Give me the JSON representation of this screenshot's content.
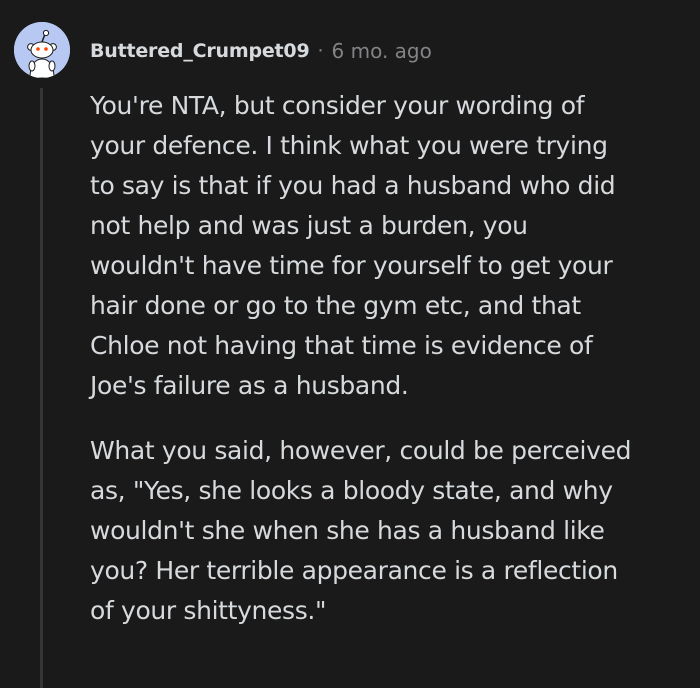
{
  "comment": {
    "avatar_icon": "snoo-avatar-icon",
    "avatar_color": "#b7c9f2",
    "username": "Buttered_Crumpet09",
    "separator": "·",
    "timestamp": "6 mo. ago",
    "paragraphs": [
      {
        "lines": [
          "You're NTA, but consider your wording of",
          "your defence. I think what you were trying",
          "to say is that if you had a husband who did",
          "not help and was just a burden, you",
          "wouldn't have time for yourself to get your",
          "hair done or go to the gym etc, and that",
          "Chloe not having that time is evidence of",
          "Joe's failure as a husband."
        ]
      },
      {
        "lines": [
          "What you said, however, could be perceived",
          "as, \"Yes, she looks a bloody state, and why",
          "wouldn't she when she has a husband like",
          "you? Her terrible appearance is a reflection",
          "of your shittyness.\""
        ]
      }
    ]
  }
}
